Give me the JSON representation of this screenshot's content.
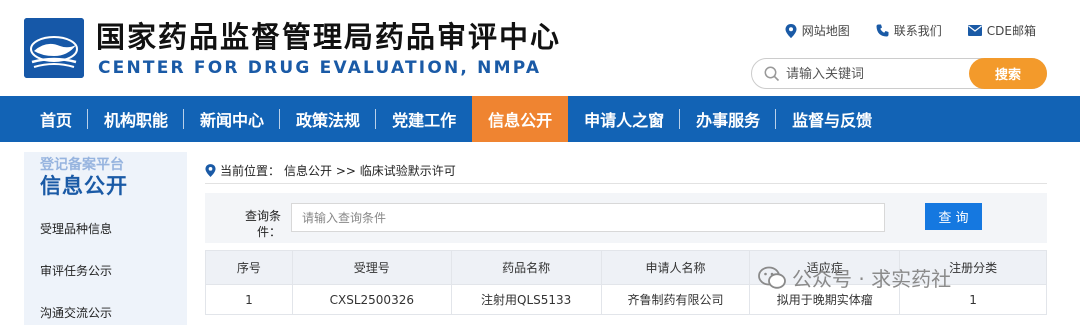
{
  "header": {
    "title_cn": "国家药品监督管理局药品审评中心",
    "title_en": "CENTER FOR DRUG EVALUATION, NMPA",
    "links": [
      "网站地图",
      "联系我们",
      "CDE邮箱"
    ],
    "search_placeholder": "请输入关键词",
    "search_button": "搜索"
  },
  "nav": {
    "items": [
      "首页",
      "机构职能",
      "新闻中心",
      "政策法规",
      "党建工作",
      "信息公开",
      "申请人之窗",
      "办事服务",
      "监督与反馈"
    ],
    "active": "信息公开"
  },
  "sidebar": {
    "ghost": "登记备案平台",
    "title": "信息公开",
    "items": [
      "受理品种信息",
      "审评任务公示",
      "沟通交流公示"
    ]
  },
  "breadcrumb": {
    "prefix": "当前位置：",
    "path": "信息公开 >> 临床试验默示许可"
  },
  "query": {
    "label": "查询条件：",
    "placeholder": "请输入查询条件",
    "button": "查 询"
  },
  "table": {
    "headers": [
      "序号",
      "受理号",
      "药品名称",
      "申请人名称",
      "适应症",
      "注册分类"
    ],
    "rows": [
      [
        "1",
        "CXSL2500326",
        "注射用QLS5133",
        "齐鲁制药有限公司",
        "拟用于晚期实体瘤",
        "1"
      ]
    ]
  },
  "watermark": "公众号 · 求实药社",
  "colors": {
    "nav": "#1263b5",
    "active": "#ef8431",
    "search_button": "#f39a2b",
    "query_button": "#1578e0"
  }
}
